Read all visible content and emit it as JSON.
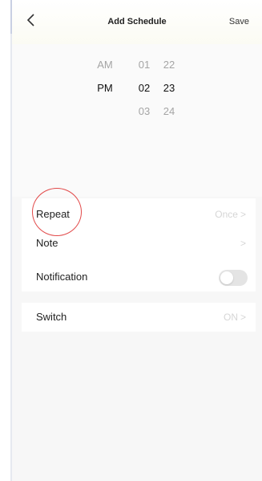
{
  "header": {
    "title": "Add Schedule",
    "save_label": "Save",
    "back_icon": "chevron-left-icon"
  },
  "picker": {
    "ampm": [
      "AM",
      "PM"
    ],
    "hours": [
      "01",
      "02",
      "03"
    ],
    "minutes": [
      "22",
      "23",
      "24"
    ],
    "selected": {
      "ampm": "PM",
      "hour": "02",
      "minute": "23"
    }
  },
  "settings": {
    "repeat": {
      "label": "Repeat",
      "value": "Once"
    },
    "note": {
      "label": "Note",
      "value": ""
    },
    "notification": {
      "label": "Notification",
      "enabled": false
    },
    "switch": {
      "label": "Switch",
      "value": "ON"
    }
  },
  "colors": {
    "annotation_circle": "#e24a4a",
    "muted_value": "#d6d6d6",
    "toggle_off": "#e4e4e4"
  }
}
